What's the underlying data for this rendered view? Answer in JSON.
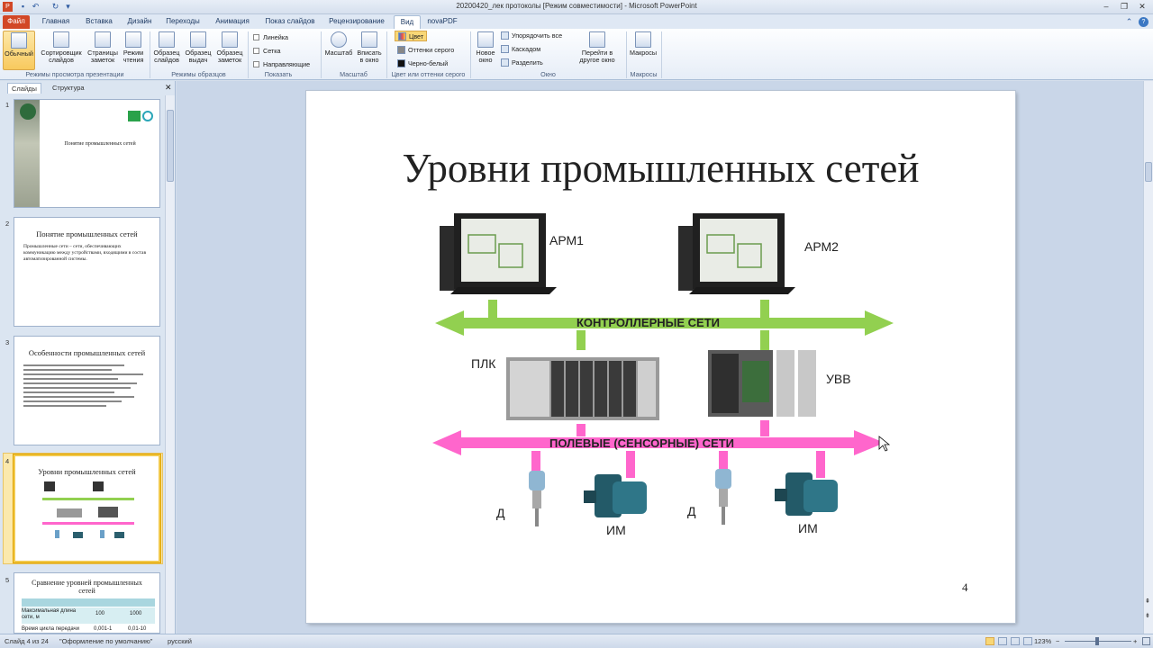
{
  "window": {
    "title": "20200420_лек протоколы [Режим совместимости] - Microsoft PowerPoint"
  },
  "ribbon_tabs": [
    "Файл",
    "Главная",
    "Вставка",
    "Дизайн",
    "Переходы",
    "Анимация",
    "Показ слайдов",
    "Рецензирование",
    "Вид",
    "novaPDF"
  ],
  "ribbon": {
    "buttons": [
      "Обычный",
      "Сортировщик слайдов",
      "Страницы заметок",
      "Режим чтения",
      "Образец слайдов",
      "Образец выдач",
      "Образец заметок",
      "Масштаб",
      "Вписать в окно",
      "Новое окно",
      "Перейти в другое окно",
      "Макросы"
    ],
    "checks": [
      "Линейка",
      "Сетка",
      "Направляющие"
    ],
    "color_items": [
      "Цвет",
      "Оттенки серого",
      "Черно-белый"
    ],
    "window_items": [
      "Упорядочить все",
      "Каскадом",
      "Разделить"
    ],
    "groups": [
      "Режимы просмотра презентации",
      "Режимы образцов",
      "Показать",
      "Масштаб",
      "Цвет или оттенки серого",
      "Окно",
      "Макросы"
    ]
  },
  "pane": {
    "tabs": [
      "Слайды",
      "Структура"
    ],
    "thumbs": [
      {
        "num": "1",
        "title": "Понятие промышленных сетей"
      },
      {
        "num": "2",
        "title": "Понятие промышленных сетей",
        "body": "Промышленные сети – сети, обеспечивающих коммуникацию между устройствами, входящими в состав автоматизированной системы."
      },
      {
        "num": "3",
        "title": "Особенности промышленных сетей"
      },
      {
        "num": "4",
        "title": "Уровни промышленных сетей"
      },
      {
        "num": "5",
        "title": "Сравнение уровней промышленных сетей"
      }
    ],
    "table5": {
      "rows": [
        [
          "Максимальная длина сети, м",
          "100",
          "1000"
        ],
        [
          "Время цикла передачи",
          "0,001-1",
          "0,01-10"
        ]
      ]
    }
  },
  "slide": {
    "title": "Уровни промышленных сетей",
    "bus_top": "КОНТРОЛЛЕРНЫЕ СЕТИ",
    "bus_bottom": "ПОЛЕВЫЕ (СЕНСОРНЫЕ) СЕТИ",
    "labels": {
      "arm1": "АРМ1",
      "arm2": "АРМ2",
      "plc": "ПЛК",
      "uvv": "УВВ",
      "d1": "Д",
      "d2": "Д",
      "im1": "ИМ",
      "im2": "ИМ"
    },
    "page_number": "4"
  },
  "status": {
    "slide": "Слайд 4 из 24",
    "theme": "\"Оформление по умолчанию\"",
    "lang": "русский",
    "zoom": "123%"
  },
  "colors": {
    "green": "#92d050",
    "pink": "#ff66cc",
    "file_tab": "#d24726"
  }
}
